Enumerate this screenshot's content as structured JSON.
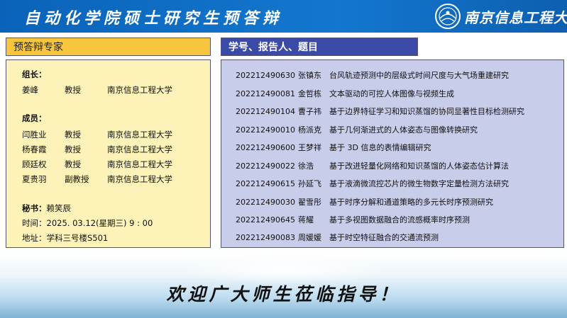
{
  "header": {
    "title": "自动化学院硕士研究生预答辩",
    "university": "南京信息工程大学",
    "logo_icon": "university-seal-icon"
  },
  "experts": {
    "section_title": "预答辩专家",
    "leader_label": "组长：",
    "leader": {
      "name": "姜峰",
      "title": "教授",
      "org": "南京信息工程大学"
    },
    "members_label": "成员：",
    "members": [
      {
        "name": "闫胜业",
        "title": "教授",
        "org": "南京信息工程大学"
      },
      {
        "name": "杨春霞",
        "title": "教授",
        "org": "南京信息工程大学"
      },
      {
        "name": "顾廷权",
        "title": "教授",
        "org": "南京信息工程大学"
      },
      {
        "name": "夏贵羽",
        "title": "副教授",
        "org": "南京信息工程大学"
      }
    ],
    "secretary_label": "秘书：",
    "secretary": "赖笑辰",
    "time_label": "时间：",
    "time": "2025. 03.12(星期三)  9 : 00",
    "place_label": "地址：",
    "place": "学科三号楼S501"
  },
  "reports": {
    "section_title": "学号、报告人、题目",
    "rows": [
      {
        "id": "202212490630",
        "name": "张镇东",
        "topic": "台风轨迹预测中的层级式时间尺度与大气场重建研究"
      },
      {
        "id": "202212490081",
        "name": "金哲栋",
        "topic": "文本驱动的可控人体图像与视频生成"
      },
      {
        "id": "202212490104",
        "name": "曹子祎",
        "topic": "基于边界特征学习和知识蒸馏的协同显著性目标检测研究"
      },
      {
        "id": "202212490010",
        "name": "杨派克",
        "topic": "基于几何渐进式的人体姿态与图像转换研究"
      },
      {
        "id": "202212490600",
        "name": "王梦祥",
        "topic": "基于 3D 信息的表情编辑研究"
      },
      {
        "id": "202212490022",
        "name": "徐浩",
        "topic": "基于改进轻量化网络和知识蒸馏的人体姿态估计算法"
      },
      {
        "id": "202212490615",
        "name": "孙延飞",
        "topic": "基于液滴微流控芯片的微生物数字定量检测方法研究"
      },
      {
        "id": "202212490030",
        "name": "翟雪彤",
        "topic": "基于时序分解和通道策略的多元长时序预测研究"
      },
      {
        "id": "202212490645",
        "name": "蒋耀",
        "topic": "基于多视图数据融合的流感概率时序预测"
      },
      {
        "id": "202212490083",
        "name": "周媛媛",
        "topic": "基于时空特征融合的交通流预测"
      }
    ]
  },
  "footer": {
    "welcome": "欢迎广大师生莅临指导！"
  }
}
